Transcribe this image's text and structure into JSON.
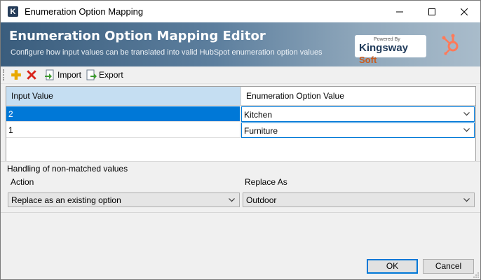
{
  "window": {
    "title": "Enumeration Option Mapping",
    "app_icon_letter": "K",
    "controls": {
      "minimize": "—",
      "maximize": "☐",
      "close": "✕"
    }
  },
  "banner": {
    "title": "Enumeration Option Mapping Editor",
    "subtitle": "Configure how input values can be translated into valid HubSpot enumeration option values",
    "logo_powered": "Powered By",
    "logo_name": "Kingsway",
    "logo_soft": "Soft",
    "hubspot_color": "#ff7a59"
  },
  "toolbar": {
    "add_icon": "plus-icon",
    "delete_icon": "x-icon",
    "import_label": "Import",
    "export_label": "Export"
  },
  "grid": {
    "columns": [
      "Input Value",
      "Enumeration Option Value"
    ],
    "rows": [
      {
        "input": "2",
        "option": "Kitchen",
        "selected": true
      },
      {
        "input": "1",
        "option": "Furniture",
        "selected": false
      }
    ]
  },
  "handling": {
    "section_label": "Handling of non-matched values",
    "action_label": "Action",
    "action_value": "Replace as an existing option",
    "replace_label": "Replace As",
    "replace_value": "Outdoor"
  },
  "buttons": {
    "ok": "OK",
    "cancel": "Cancel"
  },
  "colors": {
    "selection": "#0078d7",
    "header_selected": "#c5def2",
    "delete_red": "#d9241c",
    "add_yellow": "#e9a900"
  }
}
